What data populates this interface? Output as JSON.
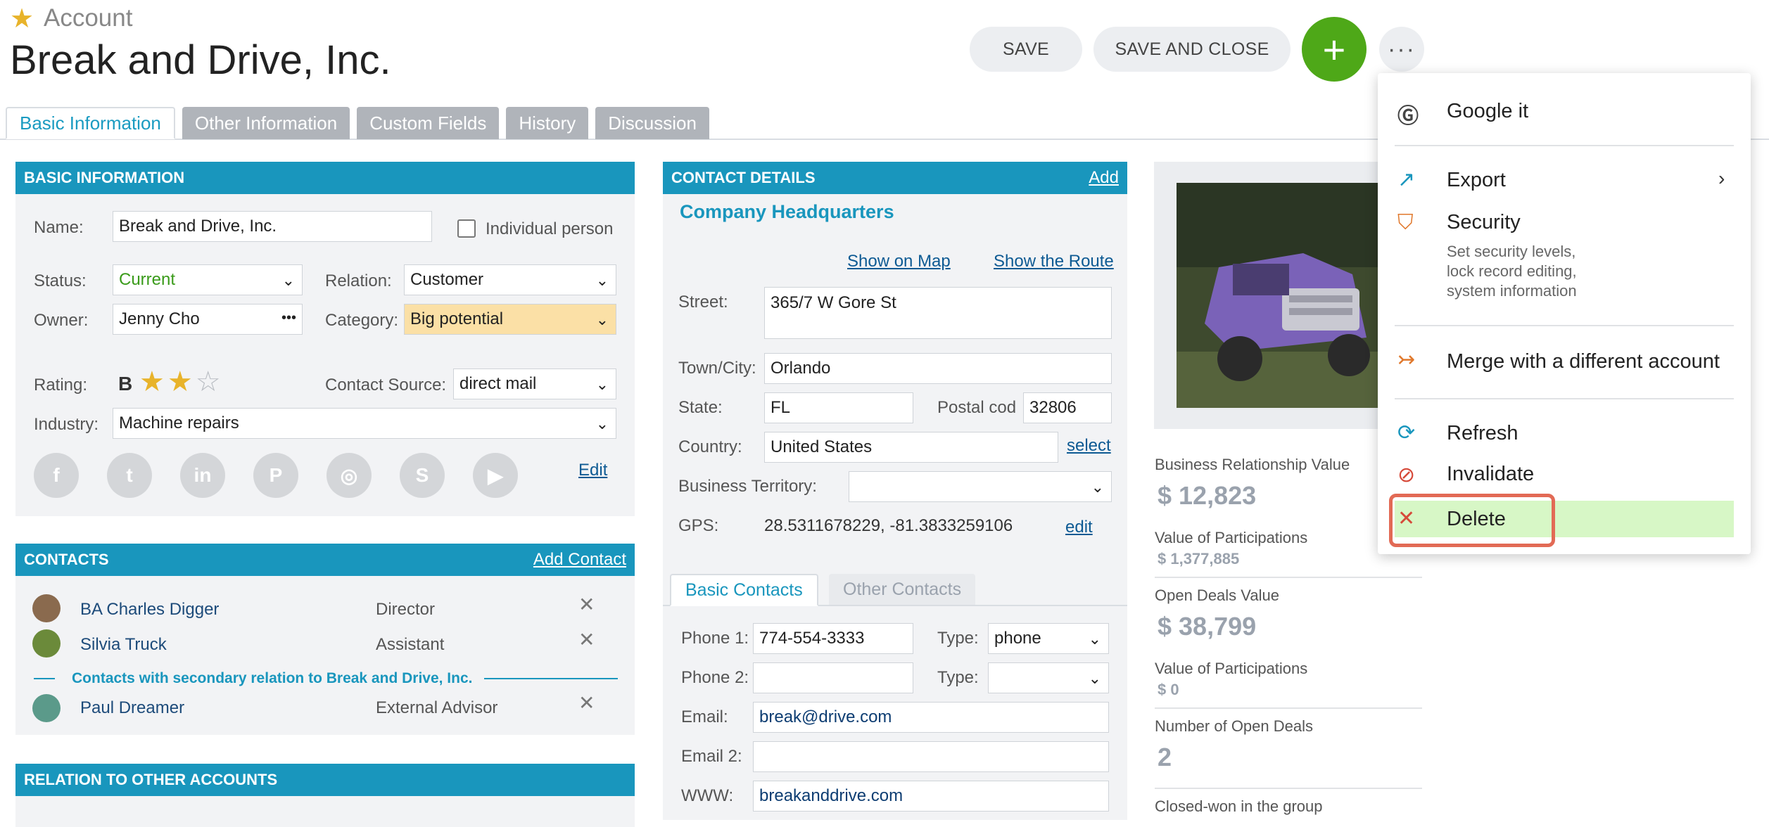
{
  "header": {
    "record_type": "Account",
    "title": "Break and Drive, Inc.",
    "save_label": "SAVE",
    "save_close_label": "SAVE AND CLOSE",
    "plus_label": "+",
    "more_label": "···"
  },
  "tabs": [
    "Basic Information",
    "Other Information",
    "Custom Fields",
    "History",
    "Discussion"
  ],
  "basic_info": {
    "heading": "BASIC INFORMATION",
    "name_label": "Name:",
    "name_value": "Break and Drive, Inc.",
    "individual_label": "Individual person",
    "status_label": "Status:",
    "status_value": "Current",
    "relation_label": "Relation:",
    "relation_value": "Customer",
    "owner_label": "Owner:",
    "owner_value": "Jenny Cho",
    "owner_more": "•••",
    "category_label": "Category:",
    "category_value": "Big potential",
    "rating_label": "Rating:",
    "rating_value": "B",
    "rating_stars": 2,
    "rating_max": 3,
    "source_label": "Contact Source:",
    "source_value": "direct mail",
    "industry_label": "Industry:",
    "industry_value": "Machine repairs",
    "social_icons": [
      "facebook-icon",
      "twitter-icon",
      "linkedin-icon",
      "pinterest-icon",
      "instagram-icon",
      "skype-icon",
      "youtube-icon"
    ],
    "social_glyphs": [
      "f",
      "t",
      "in",
      "P",
      "◎",
      "S",
      "▶"
    ],
    "edit_label": "Edit"
  },
  "contacts": {
    "heading": "CONTACTS",
    "add_label": "Add Contact",
    "items": [
      {
        "name": "BA Charles Digger",
        "role": "Director"
      },
      {
        "name": "Silvia Truck",
        "role": "Assistant"
      }
    ],
    "secondary_heading": "Contacts with secondary relation to Break and Drive, Inc.",
    "secondary_items": [
      {
        "name": "Paul Dreamer",
        "role": "External Advisor"
      }
    ]
  },
  "relation": {
    "heading": "RELATION TO OTHER ACCOUNTS"
  },
  "contact_details": {
    "heading": "CONTACT DETAILS",
    "add_label": "Add",
    "location_title": "Company Headquarters",
    "show_map": "Show on Map",
    "show_route": "Show the Route",
    "street_label": "Street:",
    "street_value": "365/7 W Gore St",
    "town_label": "Town/City:",
    "town_value": "Orlando",
    "state_label": "State:",
    "state_value": "FL",
    "postal_label": "Postal cod",
    "postal_value": "32806",
    "country_label": "Country:",
    "country_value": "United States",
    "select_label": "select",
    "territory_label": "Business Territory:",
    "territory_value": "",
    "gps_label": "GPS:",
    "gps_value": "28.5311678229, -81.3833259106",
    "gps_edit": "edit",
    "subtab_basic": "Basic Contacts",
    "subtab_other": "Other Contacts",
    "phone1_label": "Phone 1:",
    "phone1_value": "774-554-3333",
    "type1_label": "Type:",
    "type1_value": "phone",
    "phone2_label": "Phone 2:",
    "phone2_value": "",
    "type2_label": "Type:",
    "type2_value": "",
    "email_label": "Email:",
    "email_value": "break@drive.com",
    "email2_label": "Email 2:",
    "email2_value": "",
    "www_label": "WWW:",
    "www_value": "breakanddrive.com"
  },
  "stats": {
    "brv_label": "Business Relationship Value",
    "brv_value": "$ 12,823",
    "vop1_label": "Value of Participations",
    "vop1_value": "$ 1,377,885",
    "odv_label": "Open Deals Value",
    "odv_value": "$ 38,799",
    "vop2_label": "Value of Participations",
    "vop2_value": "$ 0",
    "nod_label": "Number of Open Deals",
    "nod_value": "2",
    "cw_label": "Closed-won in the group"
  },
  "menu": {
    "google": "Google it",
    "export": "Export",
    "security": "Security",
    "security_desc": "Set security levels,\nlock record editing,\nsystem information",
    "merge": "Merge with a different account",
    "refresh": "Refresh",
    "invalidate": "Invalidate",
    "delete": "Delete"
  },
  "colors": {
    "accent": "#1996bd",
    "add_button": "#4ea818",
    "status_green": "#3a9b1a",
    "category_bg": "#fbe0a6",
    "delete_highlight": "#d7f7c6",
    "delete_outline": "#e26a55"
  }
}
